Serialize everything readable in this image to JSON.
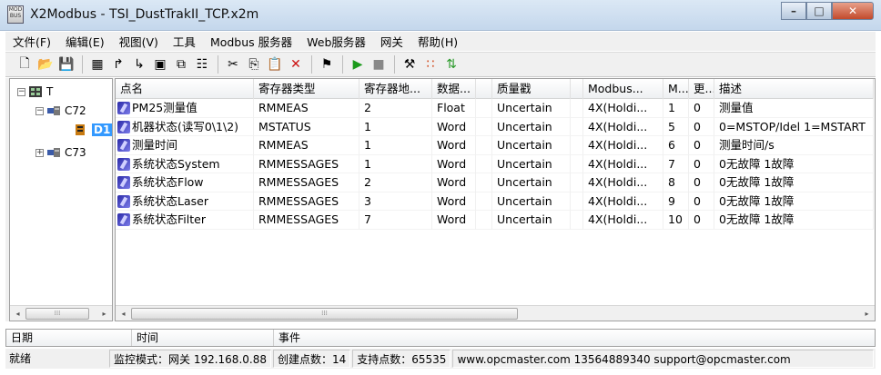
{
  "window": {
    "title": "X2Modbus - TSI_DustTrakII_TCP.x2m",
    "icon_text": "MOD BUS",
    "min_glyph": "–",
    "max_glyph": "□",
    "close_glyph": "✕"
  },
  "menu": [
    "文件(F)",
    "编辑(E)",
    "视图(V)",
    "工具",
    "Modbus 服务器",
    "Web服务器",
    "网关",
    "帮助(H)"
  ],
  "toolbar": {
    "icons": [
      "new-file-icon",
      "open-folder-icon",
      "save-icon",
      "sep",
      "add-server-icon",
      "import-icon",
      "export-icon",
      "add-group-icon",
      "copy-group-icon",
      "properties-icon",
      "sep",
      "cut-icon",
      "copy-icon",
      "paste-icon",
      "delete-icon",
      "sep",
      "device-icon",
      "sep",
      "run-icon",
      "stop-icon",
      "sep",
      "tools-icon",
      "network-icon",
      "sync-icon"
    ],
    "glyphs": {
      "new-file-icon": "🗋",
      "open-folder-icon": "📂",
      "save-icon": "💾",
      "add-server-icon": "▦",
      "import-icon": "↱",
      "export-icon": "↳",
      "add-group-icon": "▣",
      "copy-group-icon": "⧉",
      "properties-icon": "☷",
      "cut-icon": "✂",
      "copy-icon": "⎘",
      "paste-icon": "📋",
      "delete-icon": "✕",
      "device-icon": "⚑",
      "run-icon": "▶",
      "stop-icon": "■",
      "tools-icon": "⚒",
      "network-icon": "∷",
      "sync-icon": "⇅"
    },
    "colors": {
      "delete-icon": "#cc1111",
      "run-icon": "#1a9a1a",
      "stop-icon": "#888888",
      "network-icon": "#d04010",
      "sync-icon": "#2a9a2a"
    }
  },
  "tree": {
    "root": {
      "label": "T",
      "toggle": "−"
    },
    "nodes": [
      {
        "label": "C72",
        "toggle": "−"
      },
      {
        "label": "D1",
        "selected": true
      },
      {
        "label": "C73",
        "toggle": "+"
      }
    ]
  },
  "grid": {
    "headers": [
      "点名",
      "寄存器类型",
      "寄存器地...",
      "数据...",
      "",
      "质量戳",
      "",
      "Modbus...",
      "M...",
      "更...",
      "描述"
    ],
    "rows": [
      [
        "PM25测量值",
        "RMMEAS",
        "2",
        "Float",
        "",
        "Uncertain",
        "",
        "4X(Holdi...",
        "1",
        "0",
        "测量值"
      ],
      [
        "机器状态(读写0\\1\\2)",
        "MSTATUS",
        "1",
        "Word",
        "",
        "Uncertain",
        "",
        "4X(Holdi...",
        "5",
        "0",
        "0=MSTOP/Idel 1=MSTART"
      ],
      [
        "测量时间",
        "RMMEAS",
        "1",
        "Word",
        "",
        "Uncertain",
        "",
        "4X(Holdi...",
        "6",
        "0",
        "测量时间/s"
      ],
      [
        "系统状态System",
        "RMMESSAGES",
        "1",
        "Word",
        "",
        "Uncertain",
        "",
        "4X(Holdi...",
        "7",
        "0",
        "0无故障 1故障"
      ],
      [
        "系统状态Flow",
        "RMMESSAGES",
        "2",
        "Word",
        "",
        "Uncertain",
        "",
        "4X(Holdi...",
        "8",
        "0",
        "0无故障 1故障"
      ],
      [
        "系统状态Laser",
        "RMMESSAGES",
        "3",
        "Word",
        "",
        "Uncertain",
        "",
        "4X(Holdi...",
        "9",
        "0",
        "0无故障 1故障"
      ],
      [
        "系统状态Filter",
        "RMMESSAGES",
        "7",
        "Word",
        "",
        "Uncertain",
        "",
        "4X(Holdi...",
        "10",
        "0",
        "0无故障 1故障"
      ]
    ]
  },
  "log": {
    "columns": [
      "日期",
      "时间",
      "事件"
    ]
  },
  "status": {
    "ready": "就绪",
    "monitor": "监控模式：网关 192.168.0.88",
    "created": "创建点数：14",
    "supported": "支持点数：65535",
    "contact": "www.opcmaster.com 13564889340 support@opcmaster.com"
  },
  "scroll": {
    "left_arrow": "◂",
    "right_arrow": "▸",
    "grip": "⁞⁞⁞"
  }
}
